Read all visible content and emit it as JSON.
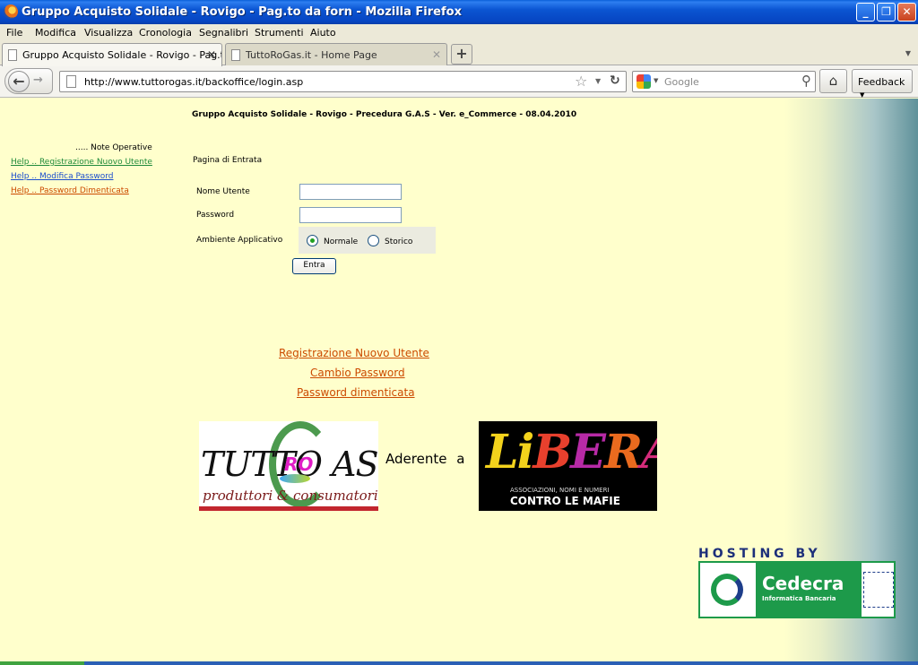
{
  "window": {
    "title": "Gruppo Acquisto Solidale - Rovigo - Pag.to da forn - Mozilla Firefox"
  },
  "menu": [
    "File",
    "Modifica",
    "Visualizza",
    "Cronologia",
    "Segnalibri",
    "Strumenti",
    "Aiuto"
  ],
  "tabs": [
    {
      "label": "Gruppo Acquisto Solidale - Rovigo - Pag.t...",
      "active": true
    },
    {
      "label": "TuttoRoGas.it - Home Page",
      "active": false
    }
  ],
  "nav": {
    "url": "http://www.tuttorogas.it/backoffice/login.asp",
    "search_placeholder": "Google",
    "feedback_label": "Feedback"
  },
  "page": {
    "header": "Gruppo Acquisto Solidale - Rovigo - Precedura G.A.S - Ver. e_Commerce - 08.04.2010",
    "note_operative": "..... Note Operative",
    "help_links": [
      "Help .. Registrazione Nuovo Utente",
      "Help .. Modifica Password",
      "Help .. Password Dimenticata"
    ],
    "section_title": "Pagina di Entrata",
    "form": {
      "username_label": "Nome Utente",
      "username_value": "",
      "password_label": "Password",
      "password_value": "",
      "environment_label": "Ambiente Applicativo",
      "options": [
        "Normale",
        "Storico"
      ],
      "selected": "Normale",
      "submit_label": "Entra"
    },
    "links": [
      "Registrazione Nuovo Utente",
      "Cambio Password",
      "Password dimenticata"
    ],
    "logo_left": {
      "main": "TUTTO  AS",
      "accent": "RO",
      "sub": "produttori & consumatori"
    },
    "aderente": "Aderente a",
    "logo_right": {
      "letters": [
        "Li",
        "B",
        "E",
        "R",
        "A"
      ],
      "line1": "ASSOCIAZIONI, NOMI E NUMERI",
      "line2": "CONTRO LE MAFIE"
    },
    "hosting": {
      "title": "HOSTING BY",
      "name": "Cedecra",
      "tagline": "Informatica Bancaria"
    }
  }
}
